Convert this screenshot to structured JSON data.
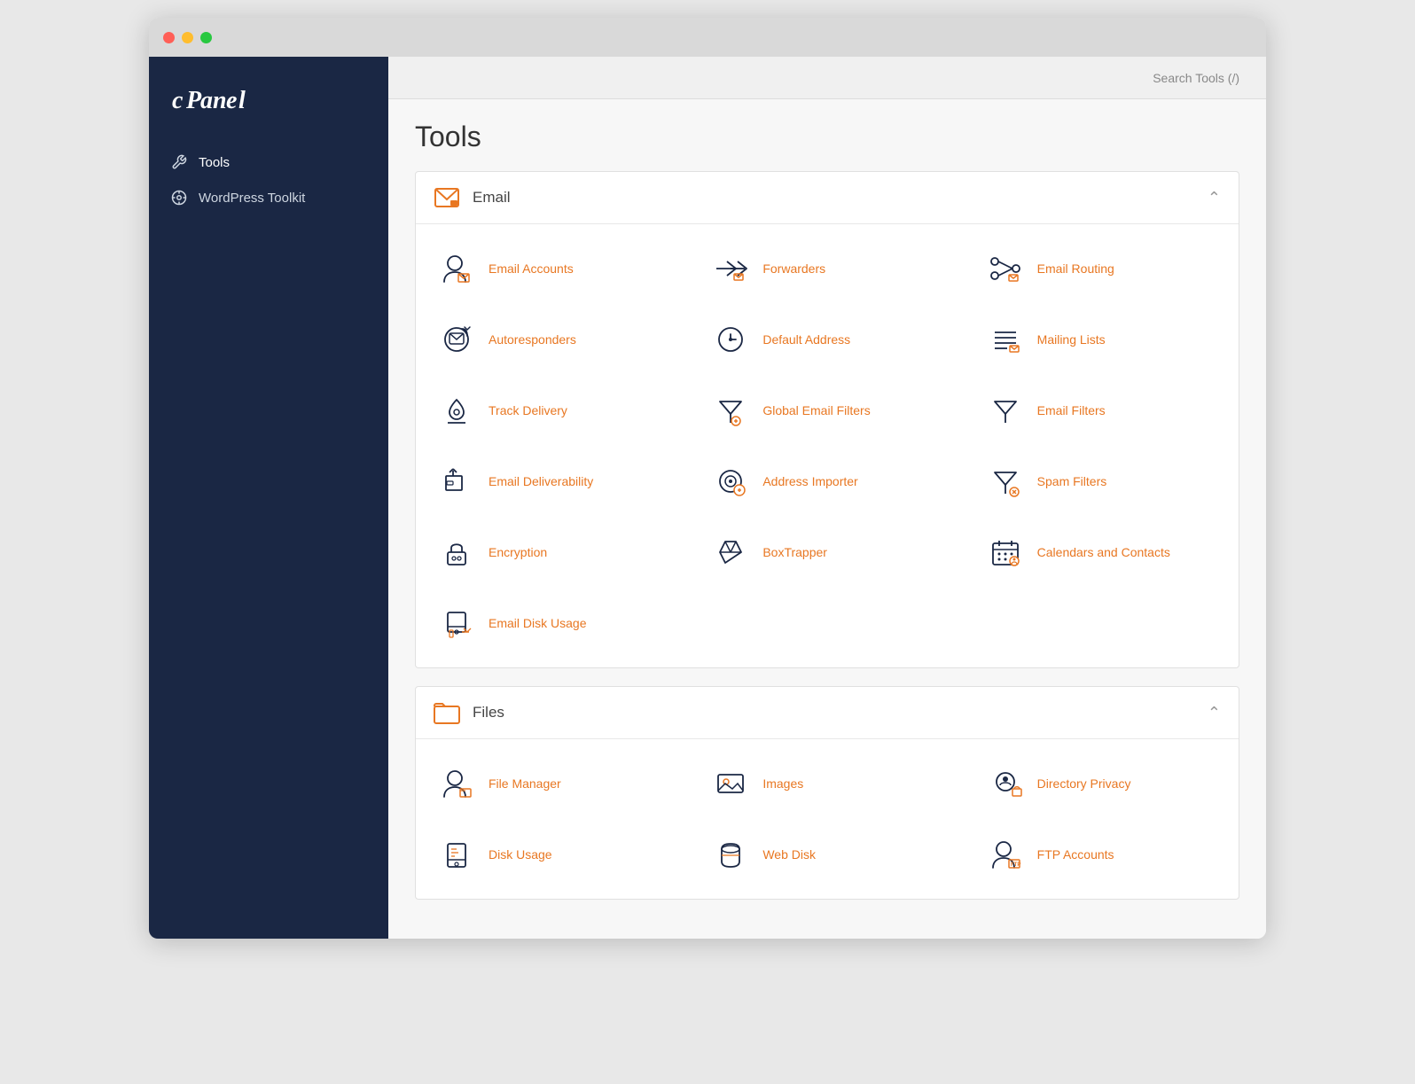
{
  "titlebar": {
    "dots": [
      "red",
      "yellow",
      "green"
    ]
  },
  "sidebar": {
    "logo": "cPanel",
    "items": [
      {
        "id": "tools",
        "label": "Tools",
        "icon": "wrench-icon",
        "active": true
      },
      {
        "id": "wordpress-toolkit",
        "label": "WordPress Toolkit",
        "icon": "wordpress-icon",
        "active": false
      }
    ]
  },
  "topbar": {
    "search_label": "Search Tools (/)"
  },
  "page": {
    "title": "Tools"
  },
  "sections": [
    {
      "id": "email",
      "title": "Email",
      "icon": "email-section-icon",
      "collapsed": false,
      "tools": [
        {
          "id": "email-accounts",
          "name": "Email Accounts",
          "icon": "email-accounts-icon"
        },
        {
          "id": "forwarders",
          "name": "Forwarders",
          "icon": "forwarders-icon"
        },
        {
          "id": "email-routing",
          "name": "Email Routing",
          "icon": "email-routing-icon"
        },
        {
          "id": "autoresponders",
          "name": "Autoresponders",
          "icon": "autoresponders-icon"
        },
        {
          "id": "default-address",
          "name": "Default Address",
          "icon": "default-address-icon"
        },
        {
          "id": "mailing-lists",
          "name": "Mailing Lists",
          "icon": "mailing-lists-icon"
        },
        {
          "id": "track-delivery",
          "name": "Track Delivery",
          "icon": "track-delivery-icon"
        },
        {
          "id": "global-email-filters",
          "name": "Global Email Filters",
          "icon": "global-email-filters-icon"
        },
        {
          "id": "email-filters",
          "name": "Email Filters",
          "icon": "email-filters-icon"
        },
        {
          "id": "email-deliverability",
          "name": "Email Deliverability",
          "icon": "email-deliverability-icon"
        },
        {
          "id": "address-importer",
          "name": "Address Importer",
          "icon": "address-importer-icon"
        },
        {
          "id": "spam-filters",
          "name": "Spam Filters",
          "icon": "spam-filters-icon"
        },
        {
          "id": "encryption",
          "name": "Encryption",
          "icon": "encryption-icon"
        },
        {
          "id": "boxtrapper",
          "name": "BoxTrapper",
          "icon": "boxtrapper-icon"
        },
        {
          "id": "calendars-contacts",
          "name": "Calendars and Contacts",
          "icon": "calendars-contacts-icon"
        },
        {
          "id": "email-disk-usage",
          "name": "Email Disk Usage",
          "icon": "email-disk-usage-icon"
        }
      ]
    },
    {
      "id": "files",
      "title": "Files",
      "icon": "files-section-icon",
      "collapsed": false,
      "tools": [
        {
          "id": "file-manager",
          "name": "File Manager",
          "icon": "file-manager-icon"
        },
        {
          "id": "images",
          "name": "Images",
          "icon": "images-icon"
        },
        {
          "id": "directory-privacy",
          "name": "Directory Privacy",
          "icon": "directory-privacy-icon"
        },
        {
          "id": "disk-usage",
          "name": "Disk Usage",
          "icon": "disk-usage-icon"
        },
        {
          "id": "web-disk",
          "name": "Web Disk",
          "icon": "web-disk-icon"
        },
        {
          "id": "ftp-accounts",
          "name": "FTP Accounts",
          "icon": "ftp-accounts-icon"
        }
      ]
    }
  ],
  "colors": {
    "accent": "#e87722",
    "sidebar_bg": "#1a2744",
    "link": "#e87722"
  }
}
